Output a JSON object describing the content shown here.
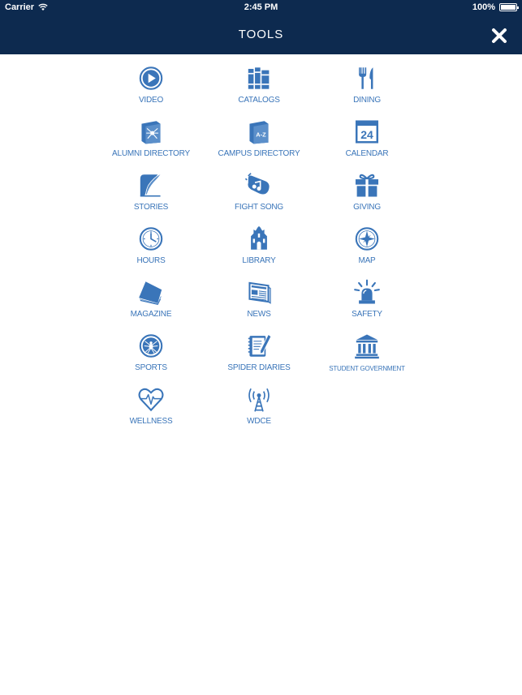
{
  "status": {
    "carrier": "Carrier",
    "time": "2:45 PM",
    "battery": "100%"
  },
  "header": {
    "title": "TOOLS"
  },
  "colors": {
    "navy": "#0d2a4f",
    "icon_blue": "#3a75b9"
  },
  "tiles": [
    {
      "label": "VIDEO",
      "icon": "play-icon"
    },
    {
      "label": "CATALOGS",
      "icon": "books-icon"
    },
    {
      "label": "DINING",
      "icon": "fork-knife-icon"
    },
    {
      "label": "ALUMNI DIRECTORY",
      "icon": "spider-book-icon"
    },
    {
      "label": "CAMPUS DIRECTORY",
      "icon": "a-z-book-icon"
    },
    {
      "label": "CALENDAR",
      "icon": "calendar-icon",
      "calendar_day": "24"
    },
    {
      "label": "STORIES",
      "icon": "quill-icon"
    },
    {
      "label": "FIGHT SONG",
      "icon": "music-note-hand-icon"
    },
    {
      "label": "GIVING",
      "icon": "gift-icon"
    },
    {
      "label": "HOURS",
      "icon": "clock-icon"
    },
    {
      "label": "LIBRARY",
      "icon": "library-tower-icon"
    },
    {
      "label": "MAP",
      "icon": "compass-icon"
    },
    {
      "label": "MAGAZINE",
      "icon": "magazine-icon"
    },
    {
      "label": "NEWS",
      "icon": "newspaper-icon"
    },
    {
      "label": "SAFETY",
      "icon": "siren-icon"
    },
    {
      "label": "SPORTS",
      "icon": "spider-ball-icon"
    },
    {
      "label": "SPIDER DIARIES",
      "icon": "notebook-pencil-icon"
    },
    {
      "label": "STUDENT GOVERNMENT",
      "icon": "government-building-icon"
    },
    {
      "label": "WELLNESS",
      "icon": "heartbeat-icon"
    },
    {
      "label": "WDCE",
      "icon": "broadcast-tower-icon"
    }
  ]
}
